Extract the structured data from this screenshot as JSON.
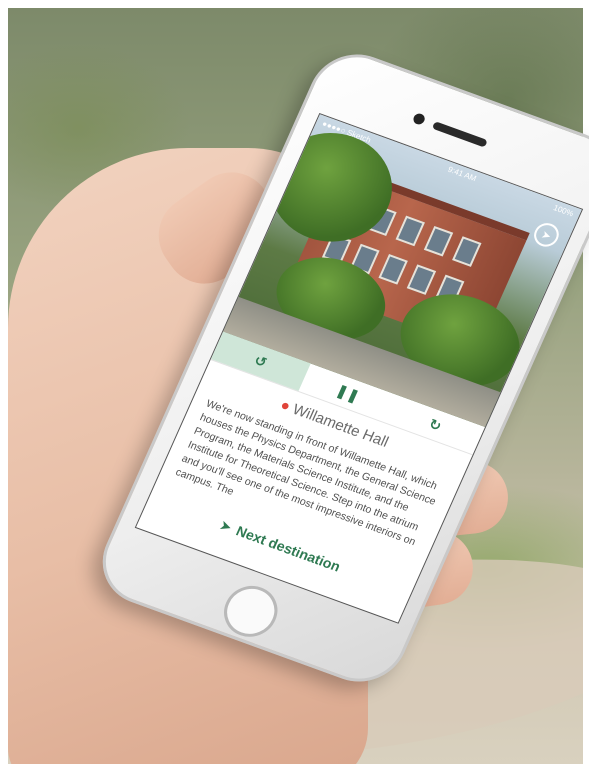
{
  "statusbar": {
    "carrier": "●●●●○ Sketch",
    "time": "9:41 AM",
    "battery": "100%"
  },
  "controls": {
    "rewind": "↺",
    "pause": "❚❚",
    "forward": "↻"
  },
  "place": {
    "name": "Willamette Hall"
  },
  "description": "We're now standing in front of Willamette Hall, which houses the Physics Department, the General Science Program, the Materials Science Institute, and the Institute for Theoretical Science. Step into the atrium and you'll see one of the most impressive interiors on campus. The",
  "next_label": "Next destination",
  "colors": {
    "accent": "#2f7a52",
    "active_tab": "#cfe6d8",
    "pin": "#e0443a"
  },
  "icons": {
    "pin": "map-pin-icon",
    "next": "navigation-arrow-icon",
    "compass": "compass-icon"
  }
}
